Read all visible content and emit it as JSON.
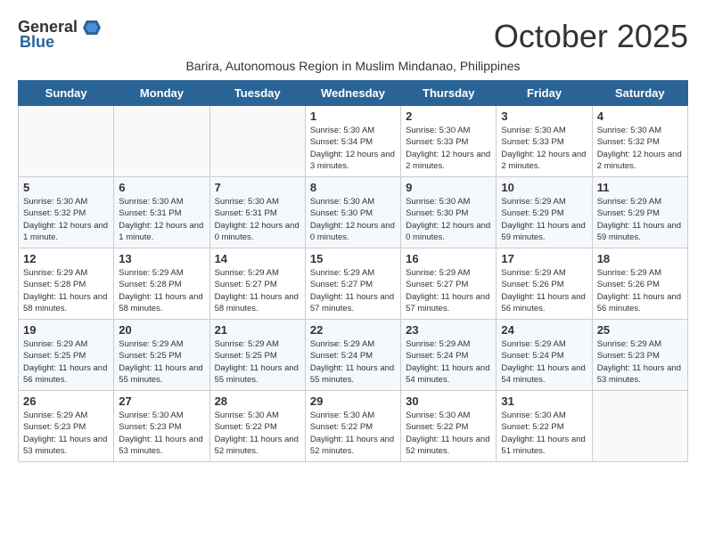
{
  "header": {
    "logo_general": "General",
    "logo_blue": "Blue",
    "month_title": "October 2025",
    "subtitle": "Barira, Autonomous Region in Muslim Mindanao, Philippines"
  },
  "weekdays": [
    "Sunday",
    "Monday",
    "Tuesday",
    "Wednesday",
    "Thursday",
    "Friday",
    "Saturday"
  ],
  "weeks": [
    [
      {
        "day": "",
        "sunrise": "",
        "sunset": "",
        "daylight": ""
      },
      {
        "day": "",
        "sunrise": "",
        "sunset": "",
        "daylight": ""
      },
      {
        "day": "",
        "sunrise": "",
        "sunset": "",
        "daylight": ""
      },
      {
        "day": "1",
        "sunrise": "Sunrise: 5:30 AM",
        "sunset": "Sunset: 5:34 PM",
        "daylight": "Daylight: 12 hours and 3 minutes."
      },
      {
        "day": "2",
        "sunrise": "Sunrise: 5:30 AM",
        "sunset": "Sunset: 5:33 PM",
        "daylight": "Daylight: 12 hours and 2 minutes."
      },
      {
        "day": "3",
        "sunrise": "Sunrise: 5:30 AM",
        "sunset": "Sunset: 5:33 PM",
        "daylight": "Daylight: 12 hours and 2 minutes."
      },
      {
        "day": "4",
        "sunrise": "Sunrise: 5:30 AM",
        "sunset": "Sunset: 5:32 PM",
        "daylight": "Daylight: 12 hours and 2 minutes."
      }
    ],
    [
      {
        "day": "5",
        "sunrise": "Sunrise: 5:30 AM",
        "sunset": "Sunset: 5:32 PM",
        "daylight": "Daylight: 12 hours and 1 minute."
      },
      {
        "day": "6",
        "sunrise": "Sunrise: 5:30 AM",
        "sunset": "Sunset: 5:31 PM",
        "daylight": "Daylight: 12 hours and 1 minute."
      },
      {
        "day": "7",
        "sunrise": "Sunrise: 5:30 AM",
        "sunset": "Sunset: 5:31 PM",
        "daylight": "Daylight: 12 hours and 0 minutes."
      },
      {
        "day": "8",
        "sunrise": "Sunrise: 5:30 AM",
        "sunset": "Sunset: 5:30 PM",
        "daylight": "Daylight: 12 hours and 0 minutes."
      },
      {
        "day": "9",
        "sunrise": "Sunrise: 5:30 AM",
        "sunset": "Sunset: 5:30 PM",
        "daylight": "Daylight: 12 hours and 0 minutes."
      },
      {
        "day": "10",
        "sunrise": "Sunrise: 5:29 AM",
        "sunset": "Sunset: 5:29 PM",
        "daylight": "Daylight: 11 hours and 59 minutes."
      },
      {
        "day": "11",
        "sunrise": "Sunrise: 5:29 AM",
        "sunset": "Sunset: 5:29 PM",
        "daylight": "Daylight: 11 hours and 59 minutes."
      }
    ],
    [
      {
        "day": "12",
        "sunrise": "Sunrise: 5:29 AM",
        "sunset": "Sunset: 5:28 PM",
        "daylight": "Daylight: 11 hours and 58 minutes."
      },
      {
        "day": "13",
        "sunrise": "Sunrise: 5:29 AM",
        "sunset": "Sunset: 5:28 PM",
        "daylight": "Daylight: 11 hours and 58 minutes."
      },
      {
        "day": "14",
        "sunrise": "Sunrise: 5:29 AM",
        "sunset": "Sunset: 5:27 PM",
        "daylight": "Daylight: 11 hours and 58 minutes."
      },
      {
        "day": "15",
        "sunrise": "Sunrise: 5:29 AM",
        "sunset": "Sunset: 5:27 PM",
        "daylight": "Daylight: 11 hours and 57 minutes."
      },
      {
        "day": "16",
        "sunrise": "Sunrise: 5:29 AM",
        "sunset": "Sunset: 5:27 PM",
        "daylight": "Daylight: 11 hours and 57 minutes."
      },
      {
        "day": "17",
        "sunrise": "Sunrise: 5:29 AM",
        "sunset": "Sunset: 5:26 PM",
        "daylight": "Daylight: 11 hours and 56 minutes."
      },
      {
        "day": "18",
        "sunrise": "Sunrise: 5:29 AM",
        "sunset": "Sunset: 5:26 PM",
        "daylight": "Daylight: 11 hours and 56 minutes."
      }
    ],
    [
      {
        "day": "19",
        "sunrise": "Sunrise: 5:29 AM",
        "sunset": "Sunset: 5:25 PM",
        "daylight": "Daylight: 11 hours and 56 minutes."
      },
      {
        "day": "20",
        "sunrise": "Sunrise: 5:29 AM",
        "sunset": "Sunset: 5:25 PM",
        "daylight": "Daylight: 11 hours and 55 minutes."
      },
      {
        "day": "21",
        "sunrise": "Sunrise: 5:29 AM",
        "sunset": "Sunset: 5:25 PM",
        "daylight": "Daylight: 11 hours and 55 minutes."
      },
      {
        "day": "22",
        "sunrise": "Sunrise: 5:29 AM",
        "sunset": "Sunset: 5:24 PM",
        "daylight": "Daylight: 11 hours and 55 minutes."
      },
      {
        "day": "23",
        "sunrise": "Sunrise: 5:29 AM",
        "sunset": "Sunset: 5:24 PM",
        "daylight": "Daylight: 11 hours and 54 minutes."
      },
      {
        "day": "24",
        "sunrise": "Sunrise: 5:29 AM",
        "sunset": "Sunset: 5:24 PM",
        "daylight": "Daylight: 11 hours and 54 minutes."
      },
      {
        "day": "25",
        "sunrise": "Sunrise: 5:29 AM",
        "sunset": "Sunset: 5:23 PM",
        "daylight": "Daylight: 11 hours and 53 minutes."
      }
    ],
    [
      {
        "day": "26",
        "sunrise": "Sunrise: 5:29 AM",
        "sunset": "Sunset: 5:23 PM",
        "daylight": "Daylight: 11 hours and 53 minutes."
      },
      {
        "day": "27",
        "sunrise": "Sunrise: 5:30 AM",
        "sunset": "Sunset: 5:23 PM",
        "daylight": "Daylight: 11 hours and 53 minutes."
      },
      {
        "day": "28",
        "sunrise": "Sunrise: 5:30 AM",
        "sunset": "Sunset: 5:22 PM",
        "daylight": "Daylight: 11 hours and 52 minutes."
      },
      {
        "day": "29",
        "sunrise": "Sunrise: 5:30 AM",
        "sunset": "Sunset: 5:22 PM",
        "daylight": "Daylight: 11 hours and 52 minutes."
      },
      {
        "day": "30",
        "sunrise": "Sunrise: 5:30 AM",
        "sunset": "Sunset: 5:22 PM",
        "daylight": "Daylight: 11 hours and 52 minutes."
      },
      {
        "day": "31",
        "sunrise": "Sunrise: 5:30 AM",
        "sunset": "Sunset: 5:22 PM",
        "daylight": "Daylight: 11 hours and 51 minutes."
      },
      {
        "day": "",
        "sunrise": "",
        "sunset": "",
        "daylight": ""
      }
    ]
  ]
}
